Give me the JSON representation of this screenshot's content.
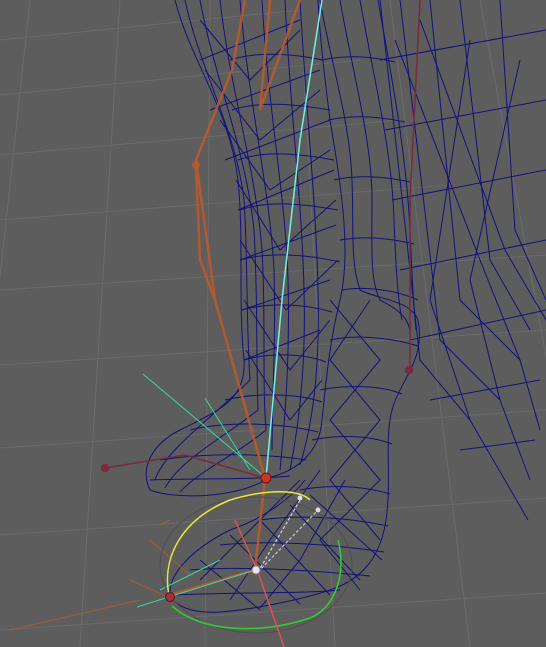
{
  "viewport": {
    "background_color": "#5d5d5d",
    "grid_color": "#6b6b6b",
    "wireframe_color": "#12127a",
    "joint_color": "#c05a2a",
    "selected_bone_color": "#6ff2e6",
    "manipulator_ring_yellow": "#e9e93a",
    "manipulator_ring_green": "#2fd02f",
    "axis_x_color": "#e05050",
    "ik_handle_color": "#7a2a3a"
  },
  "icons": [
    "joint-marker-icon",
    "ik-handle-icon",
    "rotate-manipulator-icon"
  ]
}
